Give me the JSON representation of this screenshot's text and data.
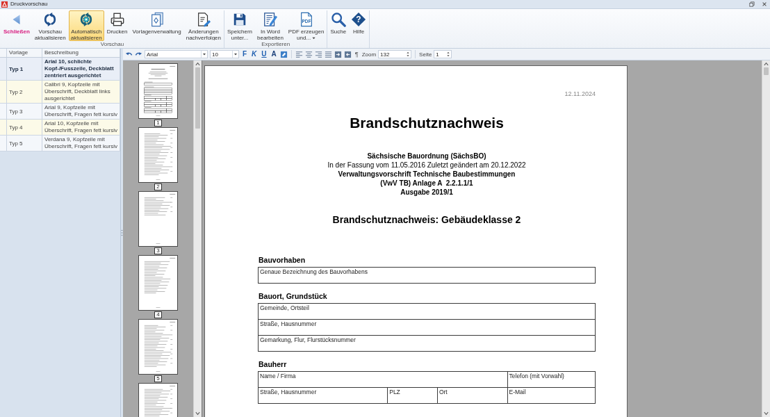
{
  "window": {
    "title": "Druckvorschau"
  },
  "ribbon": {
    "groups": [
      {
        "label": "Vorschau",
        "buttons": [
          {
            "kind": "close",
            "label": "Schließen",
            "on": false
          },
          {
            "kind": "large",
            "label": "Vorschau\naktualisieren",
            "on": false
          },
          {
            "kind": "large",
            "label": "Automatisch\naktualisieren",
            "on": true
          },
          {
            "kind": "large",
            "label": "Drucken",
            "on": false
          },
          {
            "kind": "large",
            "label": "Vorlagenverwaltung",
            "on": false
          },
          {
            "kind": "large",
            "label": "Änderungen\nnachverfolgen",
            "on": false
          }
        ]
      },
      {
        "label": "Exportieren",
        "buttons": [
          {
            "kind": "large",
            "label": "Speichern\nunter...",
            "on": false
          },
          {
            "kind": "large",
            "label": "In Word\nbearbeiten",
            "on": false
          },
          {
            "kind": "dropdown",
            "label": "PDF erzeugen\nund...",
            "icon_text": "PDF",
            "on": false
          }
        ]
      },
      {
        "buttons": [
          {
            "kind": "large",
            "label": "Suche",
            "on": false
          },
          {
            "kind": "large",
            "label": "Hilfe",
            "icon_text": "?",
            "on": false
          }
        ]
      }
    ]
  },
  "templates": {
    "columns": [
      "Vorlage",
      "Beschreibung"
    ],
    "rows": [
      {
        "name": "Typ 1",
        "description": "Arial 10, schlichte\nKopf-/Fusszeile, Deckblatt\nzentriert ausgerichtet",
        "selected": true
      },
      {
        "name": "Typ 2",
        "description": "Calibri 9, Kopfzeile mit\nÜberschrift, Deckblatt links\nausgerichtet",
        "selected": false
      },
      {
        "name": "Typ 3",
        "description": "Arial 9, Kopfzeile mit\nÜberschrift, Fragen fett kursiv",
        "selected": false
      },
      {
        "name": "Typ 4",
        "description": "Arial 10, Kopfzeile mit\nÜberschrift, Fragen fett kursiv",
        "selected": false
      },
      {
        "name": "Typ 5",
        "description": "Verdana 9, Kopfzeile mit\nÜberschrift, Fragen fett kursiv",
        "selected": false
      }
    ]
  },
  "format_bar": {
    "font": "Arial",
    "size": "10",
    "style_buttons": [
      "F",
      "K",
      "U",
      "A"
    ],
    "paragraph_mark": "¶",
    "zoom_label": "Zoom",
    "zoom": "132",
    "page_label": "Seite",
    "page": "1"
  },
  "thumbnails": [
    {
      "number": "1",
      "partial": false
    },
    {
      "number": "2",
      "partial": false
    },
    {
      "number": "3",
      "partial": false
    },
    {
      "number": "4",
      "partial": false
    },
    {
      "number": "5",
      "partial": false
    },
    {
      "partial": true
    }
  ],
  "document": {
    "date": "12.11.2024",
    "title": "Brandschutznachweis",
    "subtitle": [
      {
        "text": "Sächsische Bauordnung (SächsBO)",
        "bold": true
      },
      {
        "text": "In der Fassung vom 11.05.2016 Zuletzt geändert am 20.12.2022",
        "bold": false
      },
      {
        "text": "Verwaltungsvorschrift Technische Baubestimmungen",
        "bold": true
      },
      {
        "text": "(VwV TB) Anlage A  2.2.1.1/1",
        "bold": true
      },
      {
        "text": "Ausgabe 2019/1",
        "bold": true
      }
    ],
    "heading": "Brandschutznachweis: Gebäudeklasse 2",
    "sections": [
      {
        "title": "Bauvorhaben",
        "rows": [
          [
            "Genaue Bezeichnung des Bauvorhabens"
          ]
        ]
      },
      {
        "title": "Bauort, Grundstück",
        "rows": [
          [
            "Gemeinde, Ortsteil"
          ],
          [
            "Straße, Hausnummer"
          ],
          [
            "Gemarkung, Flur, Flurstücksnummer"
          ]
        ]
      },
      {
        "title": "Bauherr",
        "rows": [
          [
            "Name / Firma",
            "",
            "",
            "Telefon (mit Vorwahl)"
          ],
          [
            "Straße, Hausnummer",
            "PLZ",
            "Ort",
            "E-Mail"
          ]
        ]
      }
    ]
  }
}
